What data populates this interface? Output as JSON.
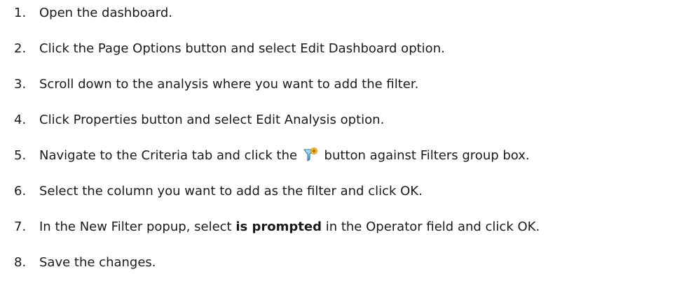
{
  "steps": [
    {
      "num": "1.",
      "text": "Open the dashboard."
    },
    {
      "num": "2.",
      "text": "Click the Page Options button and select Edit Dashboard option."
    },
    {
      "num": "3.",
      "text": "Scroll down to the analysis where you want to add the filter."
    },
    {
      "num": "4.",
      "text": "Click Properties button and select Edit Analysis option."
    },
    {
      "num": "5.",
      "text_before": "Navigate to the Criteria tab and click the",
      "icon": "add-filter-icon",
      "text_after": "button against Filters group box."
    },
    {
      "num": "6.",
      "text": "Select the column you want to add as the filter and click OK."
    },
    {
      "num": "7.",
      "text_before": "In the New Filter popup, select",
      "bold": "is prompted",
      "text_after": "in the Operator field and click OK."
    },
    {
      "num": "8.",
      "text": "Save the changes."
    }
  ]
}
